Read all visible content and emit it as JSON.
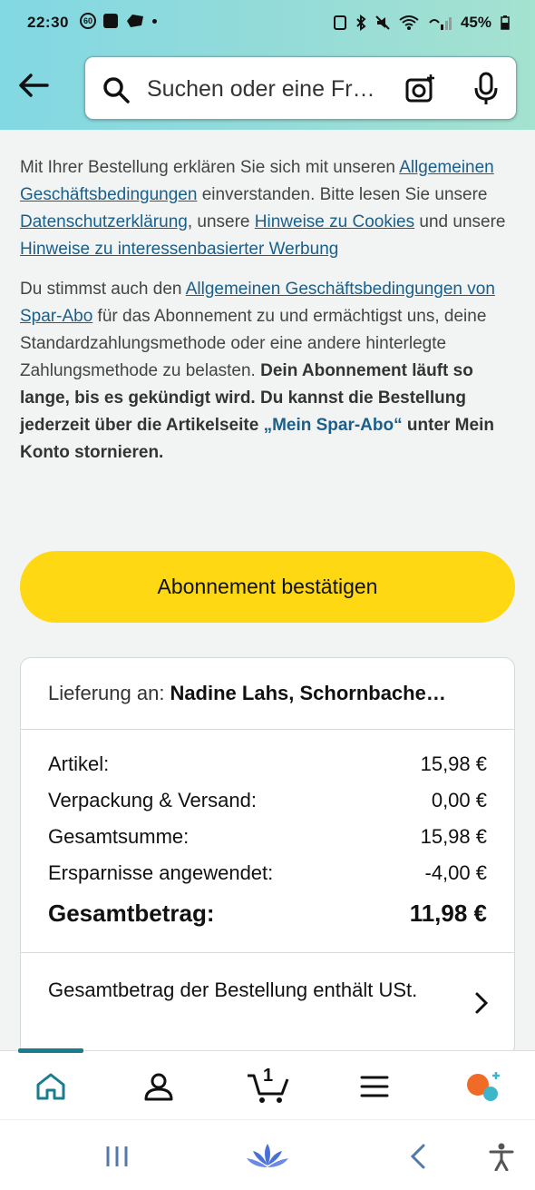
{
  "status_bar": {
    "time": "22:30",
    "badge": "60",
    "battery": "45%"
  },
  "search": {
    "placeholder": "Suchen oder eine Fr…"
  },
  "legal": {
    "p1_a": "Mit Ihrer Bestellung erklären Sie sich mit unseren ",
    "link_agb": "Allgemeinen Geschäftsbedingungen",
    "p1_b": " einverstanden. Bitte lesen Sie unsere ",
    "link_privacy": "Datenschutzerklärung",
    "p1_c": ", unsere ",
    "link_cookies": "Hinweise zu Cookies",
    "p1_d": " und unsere ",
    "link_ads": "Hinweise zu interessenbasierter Werbung",
    "p2_a": "Du stimmst auch den ",
    "link_sparabo_agb": "Allgemeinen Geschäftsbedingungen von Spar-Abo",
    "p2_b": " für das Abonnement zu und ermächtigst uns, deine Standardzahlungsmethode oder eine andere hinterlegte Zahlungsmethode zu belasten. ",
    "p2_bold_a": "Dein Abonnement läuft so lange, bis es gekündigt wird. Du kannst die Bestellung jederzeit über die Artikelseite ",
    "link_mein_sparabo": "„Mein Spar-Abo“",
    "p2_bold_b": " unter Mein Konto stornieren."
  },
  "confirm_button": "Abonnement bestätigen",
  "delivery": {
    "label": "Lieferung an:",
    "name": "Nadine Lahs, Schornbache…"
  },
  "summary": [
    {
      "label": "Artikel:",
      "value": "15,98 €"
    },
    {
      "label": "Verpackung & Versand:",
      "value": "0,00 €"
    },
    {
      "label": "Gesamtsumme:",
      "value": "15,98 €"
    },
    {
      "label": "Ersparnisse angewendet:",
      "value": "-4,00 €"
    }
  ],
  "total": {
    "label": "Gesamtbetrag:",
    "value": "11,98 €"
  },
  "vat_note": "Gesamtbetrag der Bestellung enthält USt.",
  "cart_count": "1",
  "colors": {
    "accent": "#ffd814",
    "link": "#1a5f8a",
    "teal": "#1a7d8e"
  },
  "icons": [
    "back-arrow-icon",
    "search-icon",
    "camera-icon",
    "microphone-icon",
    "home-icon",
    "account-icon",
    "cart-icon",
    "menu-icon",
    "rufus-icon",
    "recent-apps-icon",
    "home-nav-icon",
    "back-nav-icon",
    "accessibility-icon"
  ]
}
